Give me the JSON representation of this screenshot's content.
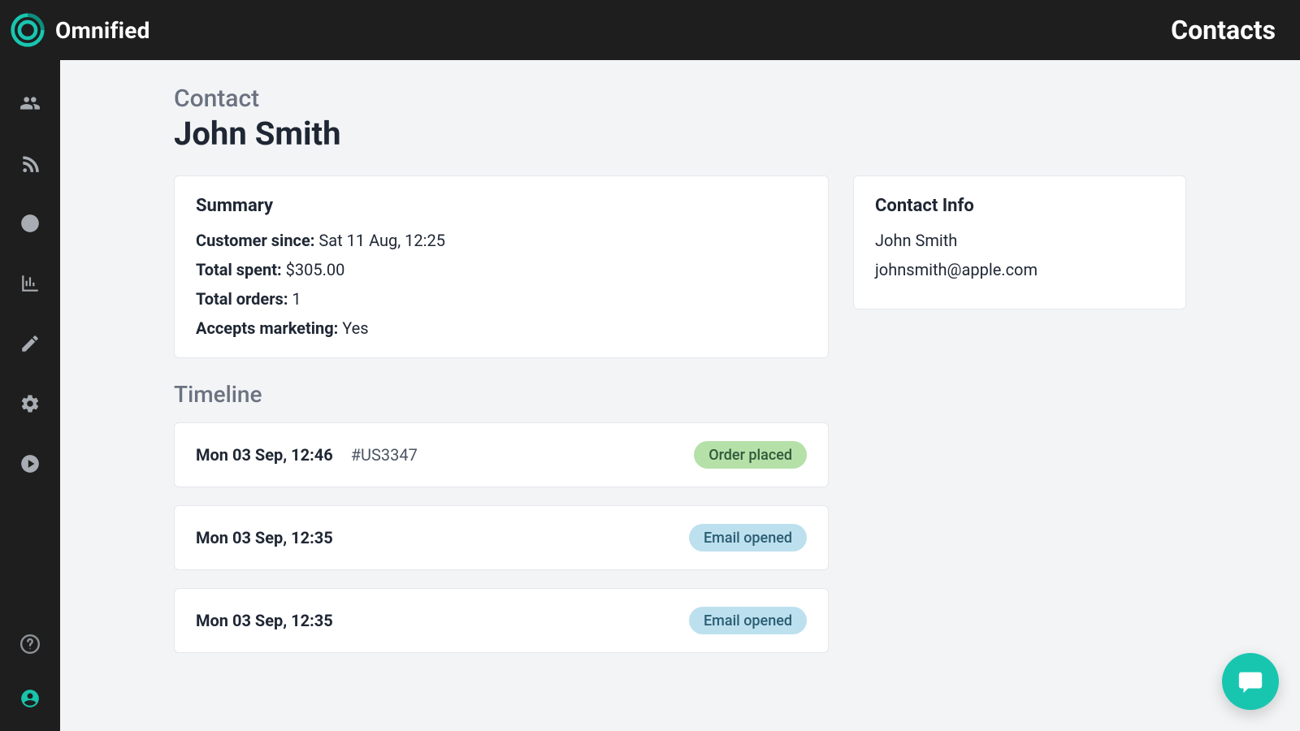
{
  "brand": {
    "name": "Omnified"
  },
  "topbar": {
    "section": "Contacts"
  },
  "sidebar_icons": [
    "people",
    "feed",
    "clock",
    "chart",
    "edit",
    "gear",
    "play"
  ],
  "page": {
    "subtitle": "Contact",
    "title": "John Smith"
  },
  "summary": {
    "title": "Summary",
    "labels": {
      "customer_since": "Customer since:",
      "total_spent": "Total spent:",
      "total_orders": "Total orders:",
      "accepts_marketing": "Accepts marketing:"
    },
    "values": {
      "customer_since": "Sat 11 Aug, 12:25",
      "total_spent": "$305.00",
      "total_orders": "1",
      "accepts_marketing": "Yes"
    }
  },
  "contact_info": {
    "title": "Contact Info",
    "name": "John Smith",
    "email": "johnsmith@apple.com"
  },
  "timeline": {
    "heading": "Timeline",
    "items": [
      {
        "datetime": "Mon 03 Sep, 12:46",
        "ref": "#US3347",
        "badge": "Order placed",
        "badge_type": "green"
      },
      {
        "datetime": "Mon 03 Sep, 12:35",
        "ref": "",
        "badge": "Email opened",
        "badge_type": "blue"
      },
      {
        "datetime": "Mon 03 Sep, 12:35",
        "ref": "",
        "badge": "Email opened",
        "badge_type": "blue"
      }
    ]
  }
}
